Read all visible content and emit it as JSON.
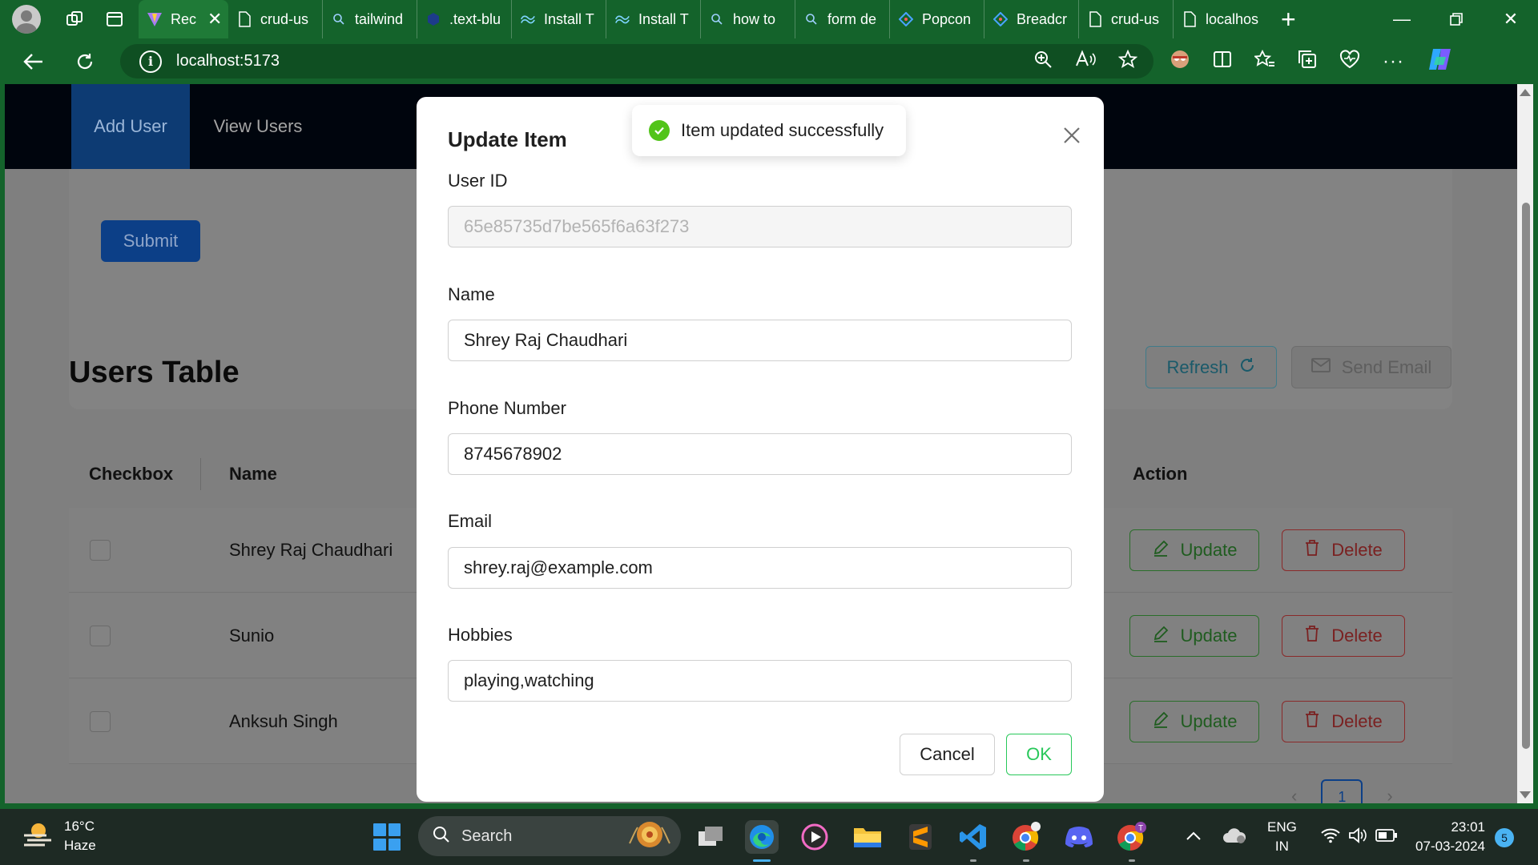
{
  "browser": {
    "tabs": [
      {
        "title": "Rec",
        "icon": "vite-icon",
        "active": true
      },
      {
        "title": "crud-us",
        "icon": "page-icon"
      },
      {
        "title": "tailwind",
        "icon": "search-icon"
      },
      {
        "title": ".text-blu",
        "icon": "site-icon"
      },
      {
        "title": "Install T",
        "icon": "tailwind-icon"
      },
      {
        "title": "Install T",
        "icon": "tailwind-icon"
      },
      {
        "title": "how to",
        "icon": "search-icon"
      },
      {
        "title": "form de",
        "icon": "search-icon"
      },
      {
        "title": "Popcon",
        "icon": "antd-icon"
      },
      {
        "title": "Breadcr",
        "icon": "antd-icon"
      },
      {
        "title": "crud-us",
        "icon": "page-icon"
      },
      {
        "title": "localhos",
        "icon": "page-icon"
      }
    ],
    "address": {
      "url": "localhost:5173"
    }
  },
  "app": {
    "nav": {
      "add_user": "Add User",
      "view_users": "View Users"
    },
    "form": {
      "submit_label": "Submit"
    },
    "table": {
      "title": "Users Table",
      "refresh_label": "Refresh",
      "send_email_label": "Send Email",
      "columns": {
        "checkbox": "Checkbox",
        "name": "Name",
        "action": "Action"
      },
      "rows": [
        {
          "name": "Shrey Raj Chaudhari",
          "update": "Update",
          "delete": "Delete"
        },
        {
          "name": "Sunio",
          "update": "Update",
          "delete": "Delete"
        },
        {
          "name": "Anksuh Singh",
          "update": "Update",
          "delete": "Delete"
        }
      ],
      "pagination": {
        "current_page": "1"
      }
    }
  },
  "modal": {
    "title": "Update Item",
    "fields": {
      "user_id": {
        "label": "User ID",
        "value": "65e85735d7be565f6a63f273"
      },
      "name": {
        "label": "Name",
        "value": "Shrey Raj Chaudhari"
      },
      "phone": {
        "label": "Phone Number",
        "value": "8745678902"
      },
      "email": {
        "label": "Email",
        "value": "shrey.raj@example.com"
      },
      "hobbies": {
        "label": "Hobbies",
        "value": "playing,watching"
      }
    },
    "cancel_label": "Cancel",
    "ok_label": "OK"
  },
  "toast": {
    "message": "Item updated successfully"
  },
  "taskbar": {
    "weather": {
      "temp": "16°C",
      "condition": "Haze"
    },
    "search_label": "Search",
    "language": {
      "line1": "ENG",
      "line2": "IN"
    },
    "clock": {
      "time": "23:01",
      "date": "07-03-2024"
    },
    "notification_count": "5"
  },
  "colors": {
    "browser_chrome": "#14632b",
    "primary": "#1677ff",
    "success": "#52c41a",
    "ok_border": "#28c85a",
    "taskbar": "#1e2a24"
  }
}
